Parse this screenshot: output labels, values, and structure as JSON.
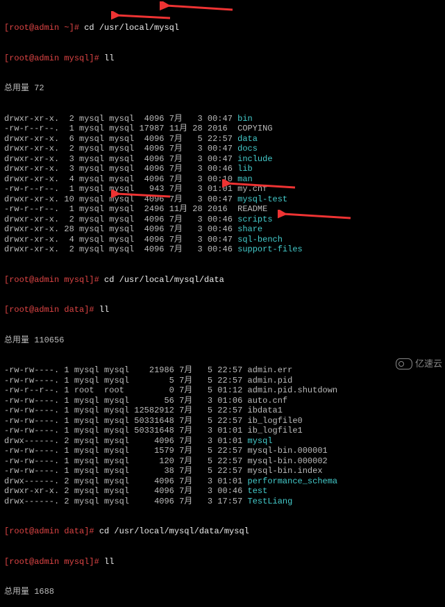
{
  "prompts": {
    "p1_user": "[root@admin ~]#",
    "p1_cmd": " cd /usr/local/mysql",
    "p2_user": "[root@admin mysql]#",
    "p2_cmd": " ll",
    "total1": "总用量 72",
    "p3_user": "[root@admin mysql]#",
    "p3_cmd": " cd /usr/local/mysql/data",
    "p4_user": "[root@admin data]#",
    "p4_cmd": " ll",
    "total2": "总用量 110656",
    "p5_user": "[root@admin data]#",
    "p5_cmd": " cd /usr/local/mysql/data/mysql",
    "p6_user": "[root@admin mysql]#",
    "p6_cmd": " ll",
    "total3": "总用量 1688"
  },
  "list1": [
    {
      "perm": "drwxr-xr-x.",
      "n": "  2",
      "u": "mysql",
      "g": "mysql",
      "size": "  4096",
      "mon": "7月 ",
      "d": "  3",
      "t": "00:47",
      "name": "bin",
      "hl": true
    },
    {
      "perm": "-rw-r--r--.",
      "n": "  1",
      "u": "mysql",
      "g": "mysql",
      "size": " 17987",
      "mon": "11月",
      "d": " 28",
      "t": "2016 ",
      "name": "COPYING",
      "hl": false
    },
    {
      "perm": "drwxr-xr-x.",
      "n": "  6",
      "u": "mysql",
      "g": "mysql",
      "size": "  4096",
      "mon": "7月 ",
      "d": "  5",
      "t": "22:57",
      "name": "data",
      "hl": true
    },
    {
      "perm": "drwxr-xr-x.",
      "n": "  2",
      "u": "mysql",
      "g": "mysql",
      "size": "  4096",
      "mon": "7月 ",
      "d": "  3",
      "t": "00:47",
      "name": "docs",
      "hl": true
    },
    {
      "perm": "drwxr-xr-x.",
      "n": "  3",
      "u": "mysql",
      "g": "mysql",
      "size": "  4096",
      "mon": "7月 ",
      "d": "  3",
      "t": "00:47",
      "name": "include",
      "hl": true
    },
    {
      "perm": "drwxr-xr-x.",
      "n": "  3",
      "u": "mysql",
      "g": "mysql",
      "size": "  4096",
      "mon": "7月 ",
      "d": "  3",
      "t": "00:46",
      "name": "lib",
      "hl": true
    },
    {
      "perm": "drwxr-xr-x.",
      "n": "  4",
      "u": "mysql",
      "g": "mysql",
      "size": "  4096",
      "mon": "7月 ",
      "d": "  3",
      "t": "00:10",
      "name": "man",
      "hl": true
    },
    {
      "perm": "-rw-r--r--.",
      "n": "  1",
      "u": "mysql",
      "g": "mysql",
      "size": "   943",
      "mon": "7月 ",
      "d": "  3",
      "t": "01:01",
      "name": "my.cnf",
      "hl": false
    },
    {
      "perm": "drwxr-xr-x.",
      "n": " 10",
      "u": "mysql",
      "g": "mysql",
      "size": "  4096",
      "mon": "7月 ",
      "d": "  3",
      "t": "00:47",
      "name": "mysql-test",
      "hl": true
    },
    {
      "perm": "-rw-r--r--.",
      "n": "  1",
      "u": "mysql",
      "g": "mysql",
      "size": "  2496",
      "mon": "11月",
      "d": " 28",
      "t": "2016 ",
      "name": "README",
      "hl": false
    },
    {
      "perm": "drwxr-xr-x.",
      "n": "  2",
      "u": "mysql",
      "g": "mysql",
      "size": "  4096",
      "mon": "7月 ",
      "d": "  3",
      "t": "00:46",
      "name": "scripts",
      "hl": true
    },
    {
      "perm": "drwxr-xr-x.",
      "n": " 28",
      "u": "mysql",
      "g": "mysql",
      "size": "  4096",
      "mon": "7月 ",
      "d": "  3",
      "t": "00:46",
      "name": "share",
      "hl": true
    },
    {
      "perm": "drwxr-xr-x.",
      "n": "  4",
      "u": "mysql",
      "g": "mysql",
      "size": "  4096",
      "mon": "7月 ",
      "d": "  3",
      "t": "00:47",
      "name": "sql-bench",
      "hl": true
    },
    {
      "perm": "drwxr-xr-x.",
      "n": "  2",
      "u": "mysql",
      "g": "mysql",
      "size": "  4096",
      "mon": "7月 ",
      "d": "  3",
      "t": "00:46",
      "name": "support-files",
      "hl": true
    }
  ],
  "list2": [
    {
      "perm": "-rw-rw----.",
      "n": " 1",
      "u": "mysql",
      "g": "mysql",
      "size": "    21986",
      "mon": "7月",
      "d": "   5",
      "t": "22:57",
      "name": "admin.err",
      "hl": false
    },
    {
      "perm": "-rw-rw----.",
      "n": " 1",
      "u": "mysql",
      "g": "mysql",
      "size": "        5",
      "mon": "7月",
      "d": "   5",
      "t": "22:57",
      "name": "admin.pid",
      "hl": false
    },
    {
      "perm": "-rw-r--r--.",
      "n": " 1",
      "u": "root ",
      "g": "root ",
      "size": "        0",
      "mon": "7月",
      "d": "   5",
      "t": "01:12",
      "name": "admin.pid.shutdown",
      "hl": false
    },
    {
      "perm": "-rw-rw----.",
      "n": " 1",
      "u": "mysql",
      "g": "mysql",
      "size": "       56",
      "mon": "7月",
      "d": "   3",
      "t": "01:06",
      "name": "auto.cnf",
      "hl": false
    },
    {
      "perm": "-rw-rw----.",
      "n": " 1",
      "u": "mysql",
      "g": "mysql",
      "size": " 12582912",
      "mon": "7月",
      "d": "   5",
      "t": "22:57",
      "name": "ibdata1",
      "hl": false
    },
    {
      "perm": "-rw-rw----.",
      "n": " 1",
      "u": "mysql",
      "g": "mysql",
      "size": " 50331648",
      "mon": "7月",
      "d": "   5",
      "t": "22:57",
      "name": "ib_logfile0",
      "hl": false
    },
    {
      "perm": "-rw-rw----.",
      "n": " 1",
      "u": "mysql",
      "g": "mysql",
      "size": " 50331648",
      "mon": "7月",
      "d": "   3",
      "t": "01:01",
      "name": "ib_logfile1",
      "hl": false
    },
    {
      "perm": "drwx------.",
      "n": " 2",
      "u": "mysql",
      "g": "mysql",
      "size": "     4096",
      "mon": "7月",
      "d": "   3",
      "t": "01:01",
      "name": "mysql",
      "hl": true
    },
    {
      "perm": "-rw-rw----.",
      "n": " 1",
      "u": "mysql",
      "g": "mysql",
      "size": "     1579",
      "mon": "7月",
      "d": "   5",
      "t": "22:57",
      "name": "mysql-bin.000001",
      "hl": false
    },
    {
      "perm": "-rw-rw----.",
      "n": " 1",
      "u": "mysql",
      "g": "mysql",
      "size": "      120",
      "mon": "7月",
      "d": "   5",
      "t": "22:57",
      "name": "mysql-bin.000002",
      "hl": false
    },
    {
      "perm": "-rw-rw----.",
      "n": " 1",
      "u": "mysql",
      "g": "mysql",
      "size": "       38",
      "mon": "7月",
      "d": "   5",
      "t": "22:57",
      "name": "mysql-bin.index",
      "hl": false
    },
    {
      "perm": "drwx------.",
      "n": " 2",
      "u": "mysql",
      "g": "mysql",
      "size": "     4096",
      "mon": "7月",
      "d": "   3",
      "t": "01:01",
      "name": "performance_schema",
      "hl": true
    },
    {
      "perm": "drwxr-xr-x.",
      "n": " 2",
      "u": "mysql",
      "g": "mysql",
      "size": "     4096",
      "mon": "7月",
      "d": "   3",
      "t": "00:46",
      "name": "test",
      "hl": true
    },
    {
      "perm": "drwx------.",
      "n": " 2",
      "u": "mysql",
      "g": "mysql",
      "size": "     4096",
      "mon": "7月",
      "d": "   3",
      "t": "17:57",
      "name": "TestLiang",
      "hl": true
    }
  ],
  "watermark": "亿速云"
}
